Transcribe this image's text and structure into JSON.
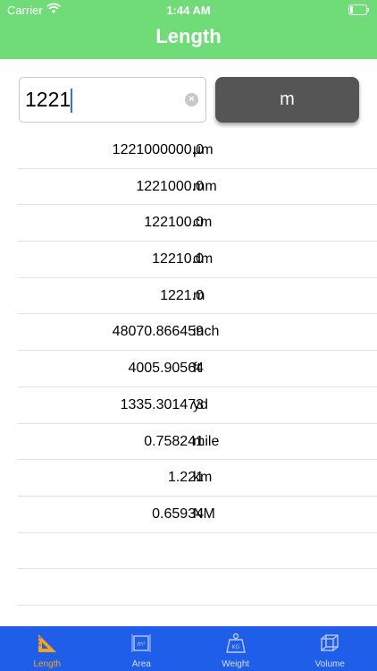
{
  "status": {
    "carrier": "Carrier",
    "time": "1:44 AM"
  },
  "header": {
    "title": "Length"
  },
  "input": {
    "value": "1221"
  },
  "unit_button": {
    "label": "m"
  },
  "results": [
    {
      "value": "1221000000.0",
      "unit": "µm"
    },
    {
      "value": "1221000.0",
      "unit": "mm"
    },
    {
      "value": "122100.0",
      "unit": "cm"
    },
    {
      "value": "12210.0",
      "unit": "dm"
    },
    {
      "value": "1221.0",
      "unit": "m"
    },
    {
      "value": "48070.866459",
      "unit": "inch"
    },
    {
      "value": "4005.90564",
      "unit": "ft"
    },
    {
      "value": "1335.301473",
      "unit": "yd"
    },
    {
      "value": "0.758241",
      "unit": "mile"
    },
    {
      "value": "1.221",
      "unit": "km"
    },
    {
      "value": "0.65934",
      "unit": "NM"
    }
  ],
  "tabs": [
    {
      "label": "Length",
      "icon": "ruler-triangle-icon",
      "active": true
    },
    {
      "label": "Area",
      "icon": "area-icon",
      "active": false
    },
    {
      "label": "Weight",
      "icon": "weight-icon",
      "active": false
    },
    {
      "label": "Volume",
      "icon": "volume-cube-icon",
      "active": false
    }
  ],
  "colors": {
    "header": "#6fdc78",
    "tabbar": "#1f5ee8",
    "active_tab": "#f7a21b",
    "unit_button": "#555555"
  }
}
